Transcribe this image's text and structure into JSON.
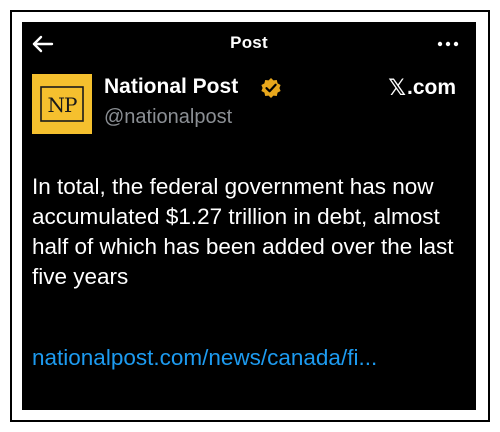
{
  "header": {
    "title": "Post",
    "back_icon": "arrow-left-icon",
    "more_icon": "more-horizontal-icon"
  },
  "author": {
    "name": "National Post",
    "handle": "@nationalpost",
    "avatar_text": "NP",
    "verified": true,
    "avatar_color": "#f5c02e"
  },
  "site": {
    "label": ".com",
    "x_glyph": "𝕏"
  },
  "tweet": {
    "text": "In total, the federal government has now accumulated $1.27 trillion in debt, almost half of which has been added over the last five years",
    "link": "nationalpost.com/news/canada/fi..."
  },
  "colors": {
    "background": "#000000",
    "text": "#ffffff",
    "secondary_text": "#8b8f94",
    "link": "#1d9bf0",
    "verified_badge": "#e8a71c"
  }
}
